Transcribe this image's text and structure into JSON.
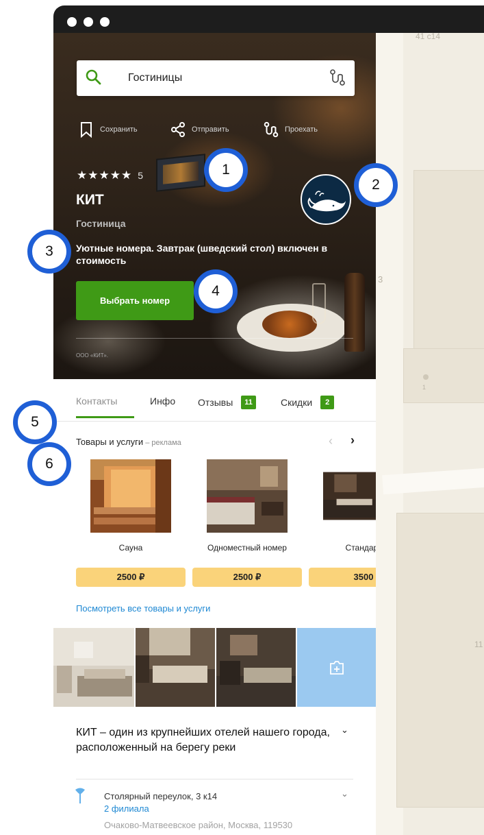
{
  "window": {
    "controls": [
      "dot",
      "dot",
      "dot"
    ]
  },
  "search": {
    "value": "Гостиницы",
    "search_icon": "search-icon",
    "route_icon": "route-icon"
  },
  "actions": [
    {
      "label": "Сохранить",
      "icon": "bookmark-icon"
    },
    {
      "label": "Отправить",
      "icon": "share-icon"
    },
    {
      "label": "Проехать",
      "icon": "route-icon"
    }
  ],
  "hotel": {
    "stars": "★★★★★",
    "rating": "5",
    "name": "КИТ",
    "type": "Гостиница",
    "promo": "Уютные номера. Завтрак (шведский стол) включен в стоимость",
    "book_label": "Выбрать номер",
    "copyright": "ООО «КИТ».",
    "logo_icon": "whale-logo-icon"
  },
  "tabs": [
    {
      "label": "Контакты",
      "active": true
    },
    {
      "label": "Инфо",
      "active": false
    },
    {
      "label": "Отзывы",
      "badge": "11"
    },
    {
      "label": "Скидки",
      "badge": "2"
    }
  ],
  "goods": {
    "title": "Товары и услуги",
    "ad_suffix": " – реклама",
    "prev": "‹",
    "next": "›",
    "items": [
      {
        "name": "Сауна",
        "price": "2500 ₽"
      },
      {
        "name": "Одноместный номер",
        "price": "2500 ₽"
      },
      {
        "name": "Стандарт",
        "price": "3500"
      }
    ],
    "all_link": "Посмотреть все товары и услуги"
  },
  "gallery": {
    "add_icon": "add-photo-icon"
  },
  "description": {
    "text": "КИТ – один из крупнейших отелей нашего города, расположенный на берегу реки",
    "chevron": "⌄"
  },
  "address": {
    "street": "Столярный переулок, 3 к14",
    "branches": "2 филиала",
    "district": "Очаково-Матвеевское район, Москва, 119530",
    "chevron": "⌄"
  },
  "map": {
    "labels": [
      "41 с14",
      "3",
      "1",
      "11"
    ]
  },
  "markers": [
    "1",
    "2",
    "3",
    "4",
    "5",
    "6"
  ],
  "colors": {
    "accent_green": "#3f9a16",
    "link_blue": "#1e88d3",
    "price_yellow": "#fad37a",
    "marker_blue": "#1f5fd6"
  }
}
